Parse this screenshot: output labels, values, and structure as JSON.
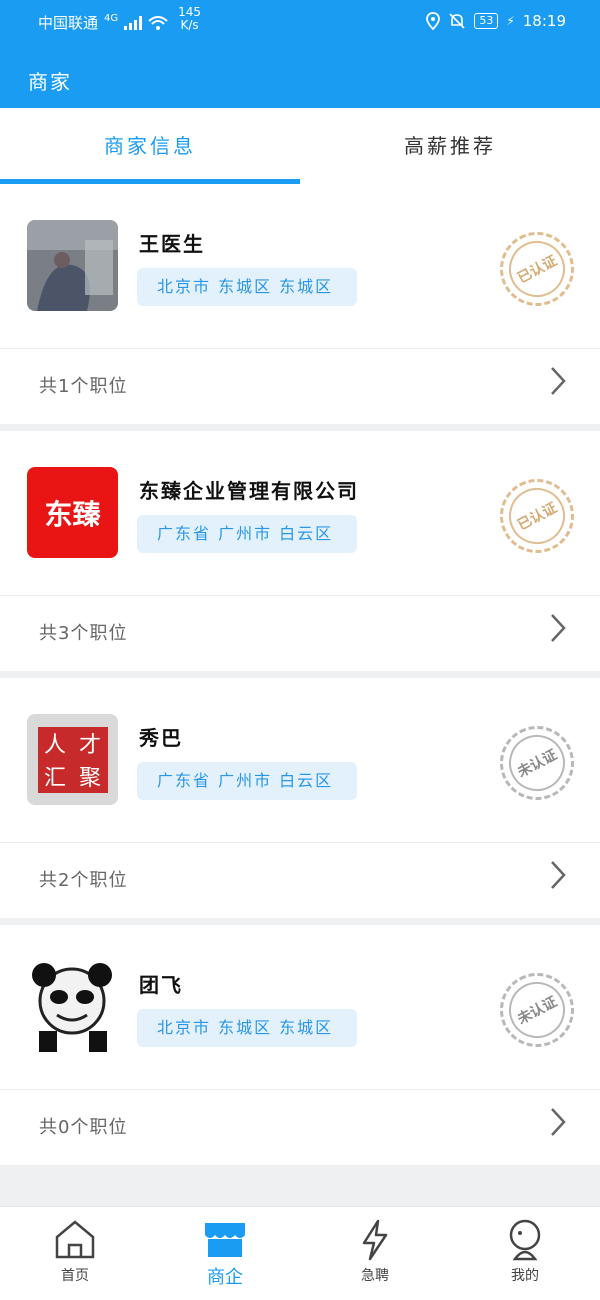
{
  "status": {
    "carrier": "中国联通",
    "network": "4G",
    "speed_value": "145",
    "speed_unit": "K/s",
    "battery": "53",
    "time": "18:19"
  },
  "appbar": {
    "title": "商家"
  },
  "tabs": [
    {
      "label": "商家信息",
      "active": true
    },
    {
      "label": "高薪推荐",
      "active": false
    }
  ],
  "companies": [
    {
      "name": "王医生",
      "location": "北京市 东城区 东城区",
      "cert": "已认证",
      "jobs": "共1个职位",
      "logo": "photo-avatar"
    },
    {
      "name": "东臻企业管理有限公司",
      "location": "广东省 广州市 白云区",
      "cert": "已认证",
      "jobs": "共3个职位",
      "logo": "dongzhen-logo",
      "logo_text": "东臻"
    },
    {
      "name": "秀巴",
      "location": "广东省 广州市 白云区",
      "cert": "未认证",
      "jobs": "共2个职位",
      "logo": "seal-logo",
      "logo_chars": [
        "人",
        "才",
        "汇",
        "聚"
      ]
    },
    {
      "name": "团飞",
      "location": "北京市 东城区 东城区",
      "cert": "未认证",
      "jobs": "共0个职位",
      "logo": "panda-meme"
    }
  ],
  "bottom_nav": [
    {
      "label": "首页",
      "icon": "home-icon"
    },
    {
      "label": "商企",
      "icon": "shop-icon",
      "active": true
    },
    {
      "label": "急聘",
      "icon": "lightning-icon"
    },
    {
      "label": "我的",
      "icon": "profile-icon"
    }
  ],
  "colors": {
    "primary": "#1a9cf2",
    "certified": "#d6aa73",
    "uncertified": "#888888"
  }
}
